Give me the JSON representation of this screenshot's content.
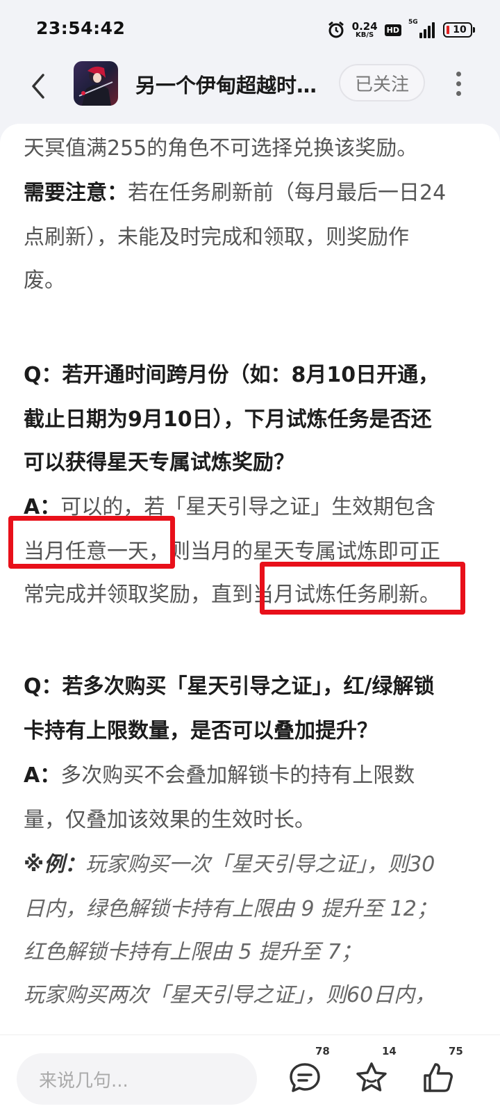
{
  "status_bar": {
    "time": "23:54:42",
    "net_speed_value": "0.24",
    "net_speed_unit": "KB/S",
    "hd": "HD",
    "network": "5G",
    "battery": "10"
  },
  "header": {
    "title": "另一个伊甸超越时…",
    "follow_label": "已关注"
  },
  "article": {
    "p1": "天冥值满255的角色不可选择兑换该奖励。",
    "note_label": "需要注意：",
    "note_line1": "若在任务刷新前（每月最后一日24",
    "note_line2": "点刷新），未能及时完成和领取，则奖励作",
    "note_line3": "废。",
    "q1_line1": "Q：若开通时间跨月份（如：8月10日开通，",
    "q1_line2": "截止日期为9月10日），下月试炼任务是否还",
    "q1_line3": "可以获得星天专属试炼奖励？",
    "a_label": "A：",
    "a1_line1": "可以的，若「星天引导之证」生效期包含",
    "a1_line2": "当月任意一天，则当月的星天专属试炼即可正",
    "a1_line3": "常完成并领取奖励，直到当月试炼任务刷新。",
    "q2_line1": "Q：若多次购买「星天引导之证」，红/绿解锁",
    "q2_line2": "卡持有上限数量，是否可以叠加提升？",
    "a2_line1": "多次购买不会叠加解锁卡的持有上限数",
    "a2_line2": "量，仅叠加该效果的生效时长。",
    "ex_label": "※例：",
    "ex_line1": "玩家购买一次「星天引导之证」，则30",
    "ex_line2": "日内，绿色解锁卡持有上限由 9 提升至 12；",
    "ex_line3": "红色解锁卡持有上限由 5 提升至 7；",
    "ex_line4": "玩家购买两次「星天引导之证」，则60日内，"
  },
  "bottom_bar": {
    "comment_placeholder": "来说几句...",
    "comment_count": "78",
    "favorite_count": "14",
    "like_count": "75"
  },
  "colors": {
    "highlight_box": "#e8101a",
    "background": "#f2f3f7"
  }
}
